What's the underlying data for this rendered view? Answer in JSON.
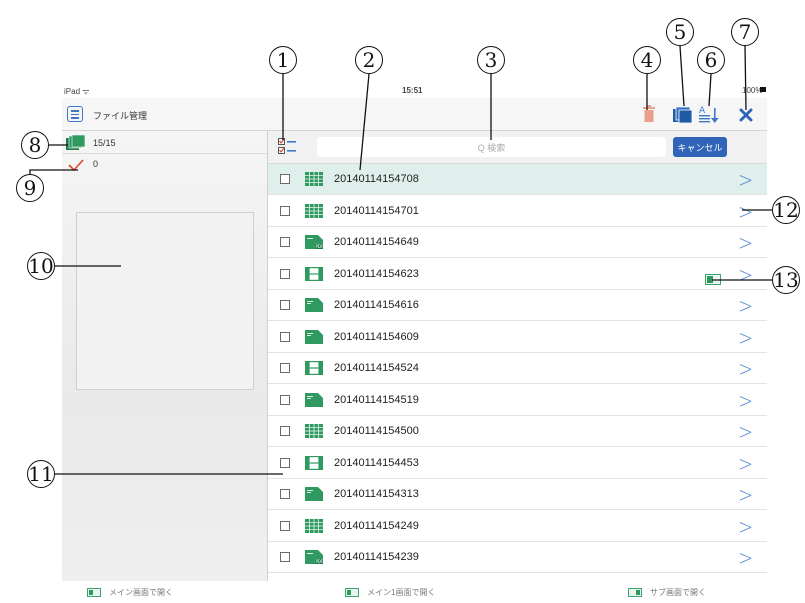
{
  "status": {
    "device": "iPad ᯤ",
    "time": "15:51",
    "battery": "100%"
  },
  "nav": {
    "title": "ファイル管理"
  },
  "left": {
    "count_label": "15/15",
    "checked_count": "0"
  },
  "search": {
    "placeholder": "Q 検索",
    "cancel_label": "キャンセル"
  },
  "files": [
    {
      "name": "20140114154708",
      "icon": "grid-doc",
      "selected": true
    },
    {
      "name": "20140114154701",
      "icon": "grid-doc"
    },
    {
      "name": "20140114154649",
      "icon": "pdf-doc"
    },
    {
      "name": "20140114154623",
      "icon": "film-doc"
    },
    {
      "name": "20140114154616",
      "icon": "green-doc"
    },
    {
      "name": "20140114154609",
      "icon": "green-doc"
    },
    {
      "name": "20140114154524",
      "icon": "film-doc"
    },
    {
      "name": "20140114154519",
      "icon": "green-doc"
    },
    {
      "name": "20140114154500",
      "icon": "grid-doc"
    },
    {
      "name": "20140114154453",
      "icon": "film-doc"
    },
    {
      "name": "20140114154313",
      "icon": "green-doc"
    },
    {
      "name": "20140114154249",
      "icon": "grid-doc"
    },
    {
      "name": "20140114154239",
      "icon": "pdf-doc"
    }
  ],
  "bottom": {
    "open_main": "メイン画面で開く",
    "open_main1": "メイン1画面で開く",
    "open_sub": "サブ画面で開く"
  },
  "callouts": [
    "1",
    "2",
    "3",
    "4",
    "5",
    "6",
    "7",
    "8",
    "9",
    "10",
    "11",
    "12",
    "13"
  ],
  "colors": {
    "accent": "#3d77c9",
    "cancel": "#2f64b8",
    "selected_row": "#dff0ec",
    "file_green": "#2f9a60",
    "trash": "#e9a08a",
    "check": "#d9472f"
  }
}
